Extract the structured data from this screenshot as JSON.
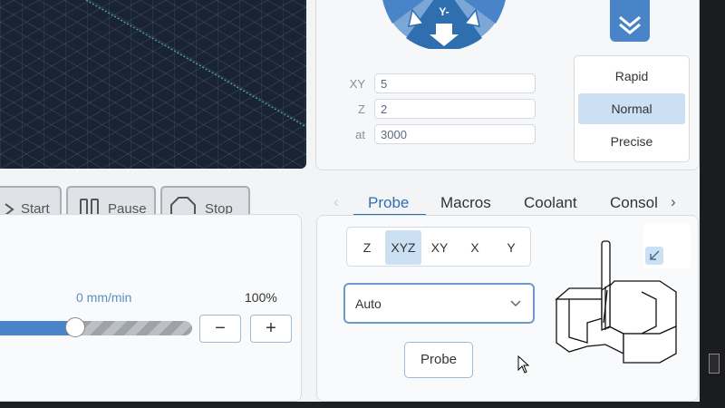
{
  "jog": {
    "wheel_label": "Y-",
    "xy_label": "XY",
    "xy_value": "5",
    "z_label": "Z",
    "z_value": "2",
    "at_label": "at",
    "at_value": "3000",
    "speed_options": [
      "Rapid",
      "Normal",
      "Precise"
    ],
    "speed_selected": "Normal",
    "collapse_icon": "chevron-double-down-icon"
  },
  "workflow": {
    "start_label": "Start",
    "pause_label": "Pause",
    "stop_label": "Stop"
  },
  "feed": {
    "rate_text": "0 mm/min",
    "override_text": "100%",
    "override_fraction": 0.39,
    "minus_label": "−",
    "plus_label": "+"
  },
  "tabs": {
    "items": [
      "Probe",
      "Macros",
      "Coolant",
      "Consol"
    ],
    "active": "Probe"
  },
  "probe": {
    "axes": [
      "Z",
      "XYZ",
      "XY",
      "X",
      "Y"
    ],
    "axis_selected": "XYZ",
    "mode_value": "Auto",
    "probe_button": "Probe"
  },
  "colors": {
    "accent": "#4a84c8",
    "selected_bg": "#cce0f4",
    "viz_bg": "#1a2333"
  }
}
